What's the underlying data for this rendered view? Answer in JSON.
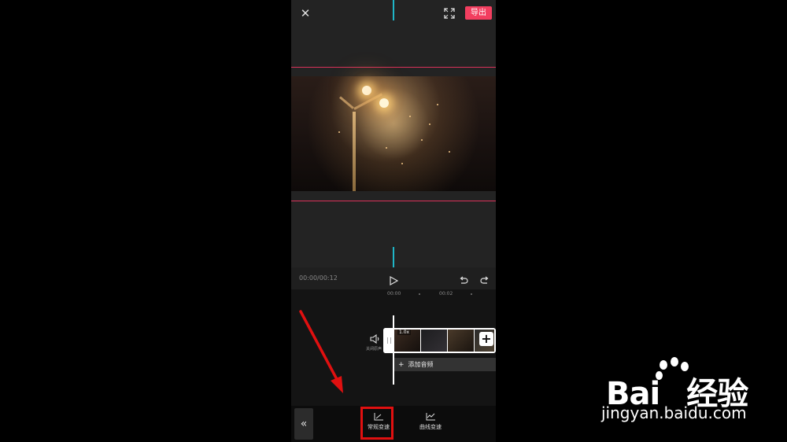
{
  "header": {
    "close_icon": "close-icon",
    "fullscreen_icon": "fullscreen-icon",
    "export_label": "导出"
  },
  "player": {
    "time": "00:00/00:12",
    "play_icon": "play-icon",
    "undo_icon": "undo-icon",
    "redo_icon": "redo-icon"
  },
  "timeline": {
    "ticks": [
      "00:00",
      "00:02"
    ],
    "mute_label": "关闭原声",
    "clip_speed_badge": "1.0x",
    "add_audio_label": "添加音频"
  },
  "toolbar": {
    "collapse_icon": "double-chevron-left-icon",
    "tools": [
      {
        "label": "常规变速",
        "icon": "speed-graph-icon"
      },
      {
        "label": "曲线变速",
        "icon": "curve-graph-icon"
      }
    ]
  },
  "watermark": {
    "brand": "Bai",
    "brand_cn": "经验",
    "url": "jingyan.baidu.com"
  },
  "colors": {
    "accent": "#f23e5f",
    "guide_cyan": "#1fb6c7",
    "guide_red": "#d9325a",
    "annotation_red": "#e01010"
  }
}
